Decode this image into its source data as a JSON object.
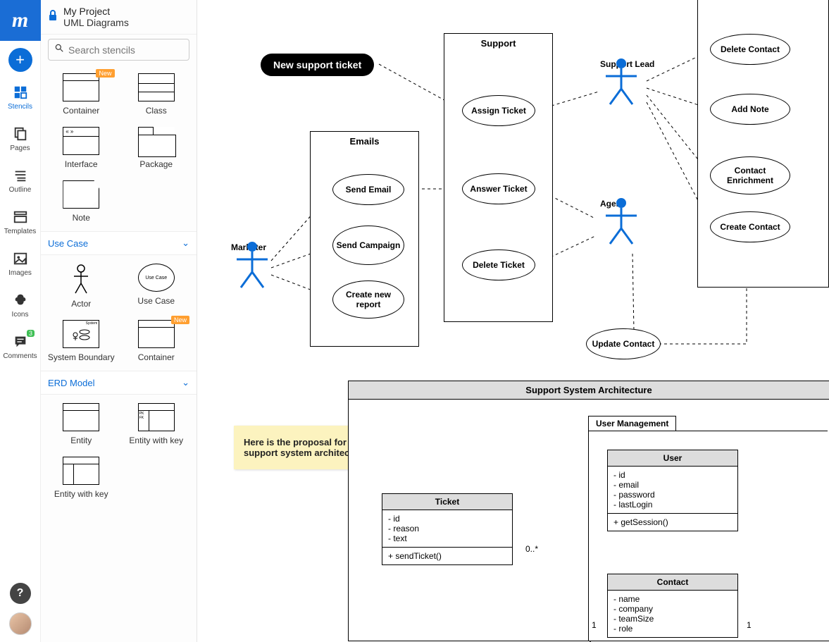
{
  "header": {
    "project": "My Project",
    "doc": "UML Diagrams"
  },
  "search": {
    "placeholder": "Search stencils"
  },
  "rail": {
    "items": [
      "Stencils",
      "Pages",
      "Outline",
      "Templates",
      "Images",
      "Icons",
      "Comments"
    ],
    "comments_badge": "3"
  },
  "sections": {
    "usecase": "Use Case",
    "erd": "ERD Model"
  },
  "stencils": {
    "r1": [
      "Container",
      "Class"
    ],
    "r2": [
      "Interface",
      "Package"
    ],
    "r3": [
      "Note",
      ""
    ],
    "uc": [
      "Actor",
      "Use Case",
      "System Boundary",
      "Container"
    ],
    "erd": [
      "Entity",
      "Entity with key",
      "Entity with key"
    ]
  },
  "new_tag": "New",
  "diagram": {
    "comment_pill": "New support ticket",
    "actors": {
      "marketer": "Marketer",
      "support_lead": "Support Lead",
      "agent": "Agent"
    },
    "boundaries": {
      "emails": "Emails",
      "support": "Support"
    },
    "usecases": {
      "send_email": "Send Email",
      "send_campaign": "Send Campaign",
      "create_report": "Create new report",
      "assign_ticket": "Assign Ticket",
      "answer_ticket": "Answer Ticket",
      "delete_ticket": "Delete Ticket",
      "update_contact": "Update Contact",
      "delete_contact": "Delete Contact",
      "add_note": "Add Note",
      "contact_enrichment": "Contact Enrichment",
      "create_contact": "Create Contact"
    },
    "sticky": "Here is the proposal for the support system architecture",
    "packages": {
      "arch": "Support System Architecture",
      "user_mgmt": "User Management"
    },
    "classes": {
      "ticket": {
        "name": "Ticket",
        "attrs": "- id\n- reason\n- text",
        "ops": "+ sendTicket()"
      },
      "user": {
        "name": "User",
        "attrs": "- id\n- email\n- password\n- lastLogin",
        "ops": "+ getSession()"
      },
      "contact": {
        "name": "Contact",
        "attrs": "- name\n- company\n- teamSize\n- role"
      }
    },
    "rel": {
      "many": "0..*",
      "one_a": "1",
      "one_b": "1"
    }
  }
}
